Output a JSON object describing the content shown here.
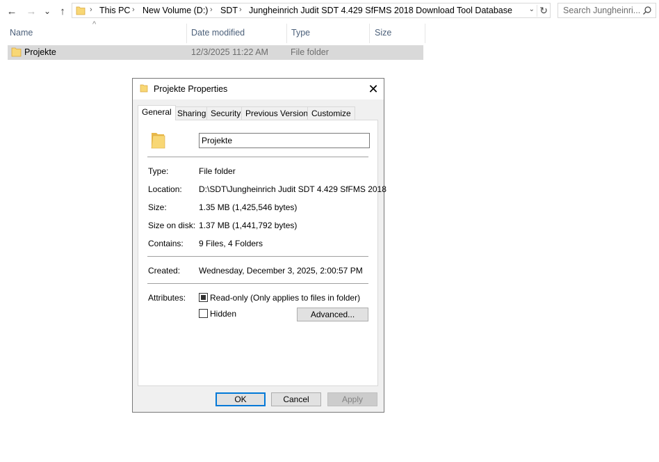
{
  "nav": {
    "back": "←",
    "forward": "→",
    "recent": "⌄",
    "up": "↑"
  },
  "address": {
    "separator": "›",
    "crumbs": [
      "This PC",
      "New Volume (D:)",
      "SDT",
      "Jungheinrich Judit SDT 4.429 SfFMS 2018 Download Tool Database"
    ],
    "dropdown": "⌄",
    "refresh": "↻"
  },
  "search": {
    "placeholder": "Search Jungheinri..."
  },
  "columns": {
    "sort_caret": "^",
    "name": "Name",
    "date": "Date modified",
    "type": "Type",
    "size": "Size"
  },
  "files": [
    {
      "name": "Projekte",
      "date": "12/3/2025 11:22 AM",
      "type": "File folder",
      "size": ""
    }
  ],
  "dialog": {
    "title": "Projekte Properties",
    "close": "✕",
    "tabs": [
      "General",
      "Sharing",
      "Security",
      "Previous Versions",
      "Customize"
    ],
    "active_tab": "General",
    "folder_name": "Projekte",
    "rows": {
      "type": {
        "label": "Type:",
        "value": "File folder"
      },
      "location": {
        "label": "Location:",
        "value": "D:\\SDT\\Jungheinrich Judit SDT 4.429 SfFMS 2018"
      },
      "size": {
        "label": "Size:",
        "value": "1.35 MB (1,425,546 bytes)"
      },
      "size_on_disk": {
        "label": "Size on disk:",
        "value": "1.37 MB (1,441,792 bytes)"
      },
      "contains": {
        "label": "Contains:",
        "value": "9 Files, 4 Folders"
      },
      "created": {
        "label": "Created:",
        "value": "Wednesday, December 3, 2025, 2:00:57 PM"
      }
    },
    "attributes": {
      "label": "Attributes:",
      "readonly": {
        "label": "Read-only (Only applies to files in folder)",
        "state": "indeterminate"
      },
      "hidden": {
        "label": "Hidden",
        "checked": false
      },
      "advanced": "Advanced..."
    },
    "buttons": {
      "ok": "OK",
      "cancel": "Cancel",
      "apply": "Apply"
    }
  },
  "colors": {
    "selection": "#d9d9d9",
    "focus_border": "#0078d7",
    "folder_yellow": "#f8d775",
    "header_text": "#4c607a"
  }
}
